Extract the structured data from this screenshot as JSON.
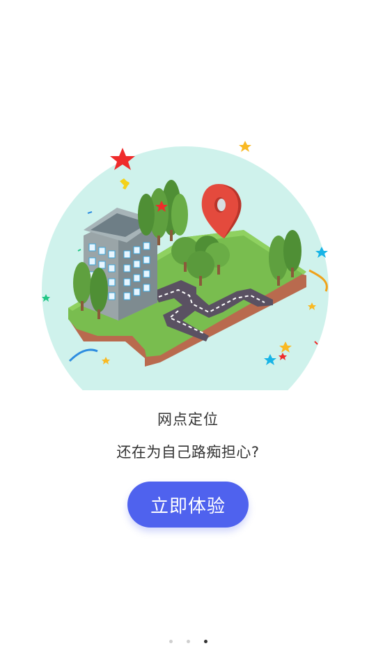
{
  "onboarding": {
    "title": "网点定位",
    "subtitle": "还在为自己路痴担心?",
    "cta_label": "立即体验",
    "illustration_icon": "map-location-icon"
  },
  "pager": {
    "pages": [
      1,
      2,
      3
    ],
    "active_index": 3
  },
  "colors": {
    "accent": "#4f62ee",
    "circle_bg": "#cff2ec",
    "pin": "#e44a3d",
    "grass": "#79bd4f",
    "road": "#5a5162"
  }
}
